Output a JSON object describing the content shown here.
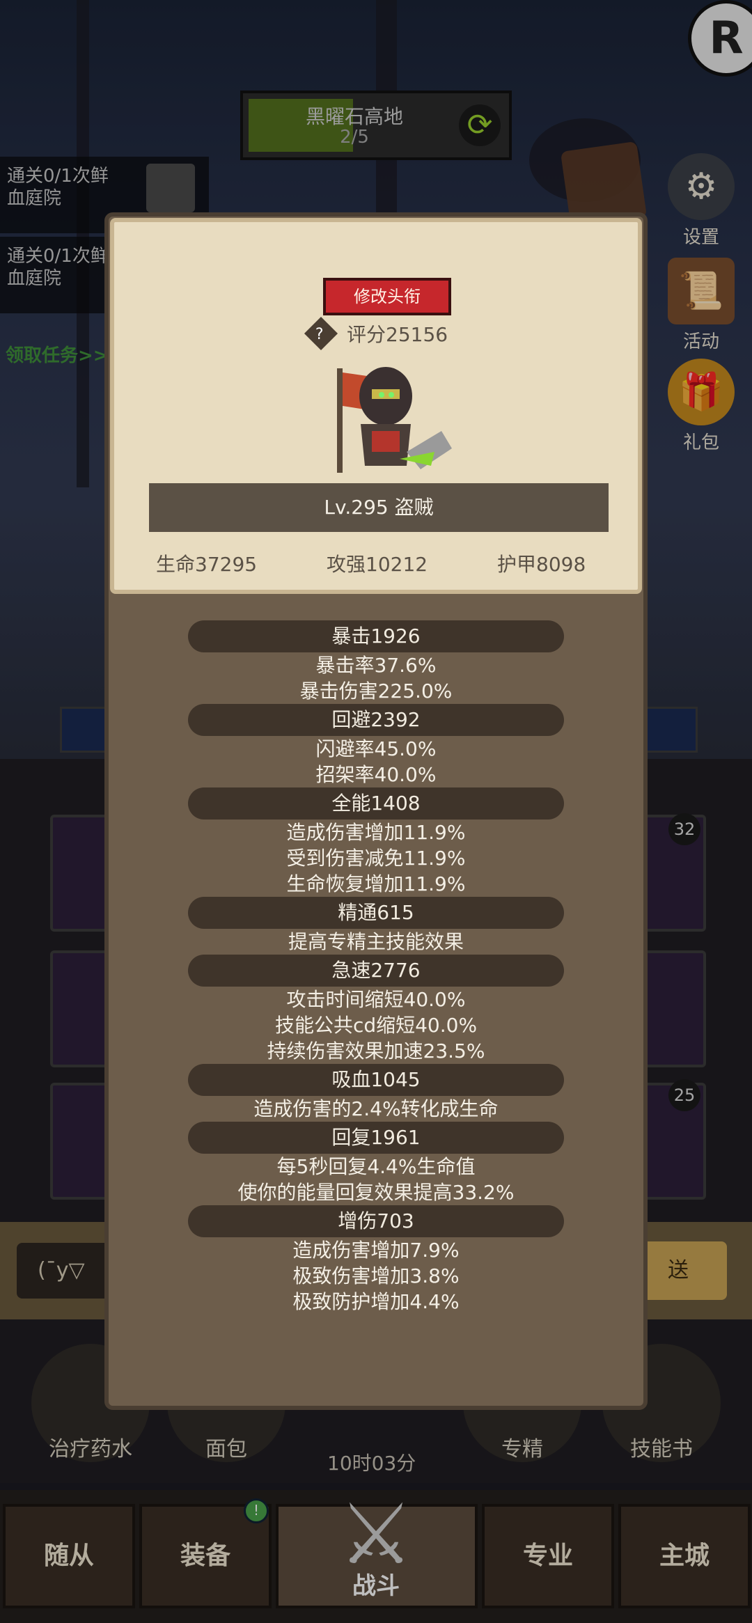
{
  "stage": {
    "name": "黑曜石高地",
    "progress_text": "2/5",
    "progress_fraction": 0.4,
    "refresh_icon": "refresh-icon"
  },
  "quests": [
    {
      "line1": "通关0/1次鲜",
      "line2": "血庭院"
    },
    {
      "line1": "通关0/1次鲜",
      "line2": "血庭院"
    }
  ],
  "claim_task": "领取任务>>",
  "right_menu": [
    {
      "label": "设置",
      "icon": "gear-icon"
    },
    {
      "label": "活动",
      "icon": "scroll-icon"
    },
    {
      "label": "礼包",
      "icon": "gift-icon"
    }
  ],
  "slot_counts": {
    "slot_right_top": "32",
    "slot_right_bottom": "25"
  },
  "chat": {
    "input_text": "(ˉy▽",
    "send_label": "送"
  },
  "items": [
    {
      "label": "治疗药水"
    },
    {
      "label": "面包"
    },
    {
      "label": "专精"
    },
    {
      "label": "技能书"
    }
  ],
  "timer": "10时03分",
  "bottom_nav": [
    {
      "label": "随从"
    },
    {
      "label": "装备"
    },
    {
      "label": "战斗"
    },
    {
      "label": "专业"
    },
    {
      "label": "主城"
    }
  ],
  "equip_notice": "!",
  "panel": {
    "title_button": "修改头衔",
    "score": "评分25156",
    "score_icon": "?",
    "level_class": "Lv.295 盗贼",
    "stats": {
      "hp": "生命37295",
      "attack": "攻强10212",
      "armor": "护甲8098"
    },
    "groups": [
      {
        "header": "暴击1926",
        "lines": [
          "暴击率37.6%",
          "暴击伤害225.0%"
        ]
      },
      {
        "header": "回避2392",
        "lines": [
          "闪避率45.0%",
          "招架率40.0%"
        ]
      },
      {
        "header": "全能1408",
        "lines": [
          "造成伤害增加11.9%",
          "受到伤害减免11.9%",
          "生命恢复增加11.9%"
        ]
      },
      {
        "header": "精通615",
        "lines": [
          "提高专精主技能效果"
        ]
      },
      {
        "header": "急速2776",
        "lines": [
          "攻击时间缩短40.0%",
          "技能公共cd缩短40.0%",
          "持续伤害效果加速23.5%"
        ]
      },
      {
        "header": "吸血1045",
        "lines": [
          "造成伤害的2.4%转化成生命"
        ]
      },
      {
        "header": "回复1961",
        "lines": [
          "每5秒回复4.4%生命值",
          "使你的能量回复效果提高33.2%"
        ]
      },
      {
        "header": "增伤703",
        "lines": [
          "造成伤害增加7.9%",
          "极致伤害增加3.8%",
          "极致防护增加4.4%"
        ]
      }
    ]
  }
}
